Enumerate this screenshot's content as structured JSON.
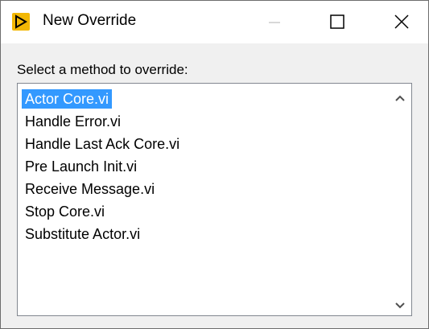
{
  "window": {
    "title": "New Override",
    "icon": "labview-arrow-icon",
    "controls": {
      "minimize": "minimize-icon",
      "maximize": "maximize-icon",
      "close": "close-icon"
    },
    "accent": "#f2b705"
  },
  "dialog": {
    "prompt": "Select a method to override:",
    "methods": [
      "Actor Core.vi",
      "Handle Error.vi",
      "Handle Last Ack Core.vi",
      "Pre Launch Init.vi",
      "Receive Message.vi",
      "Stop Core.vi",
      "Substitute Actor.vi"
    ],
    "selected_index": 0,
    "selection_color": "#3399ff"
  }
}
